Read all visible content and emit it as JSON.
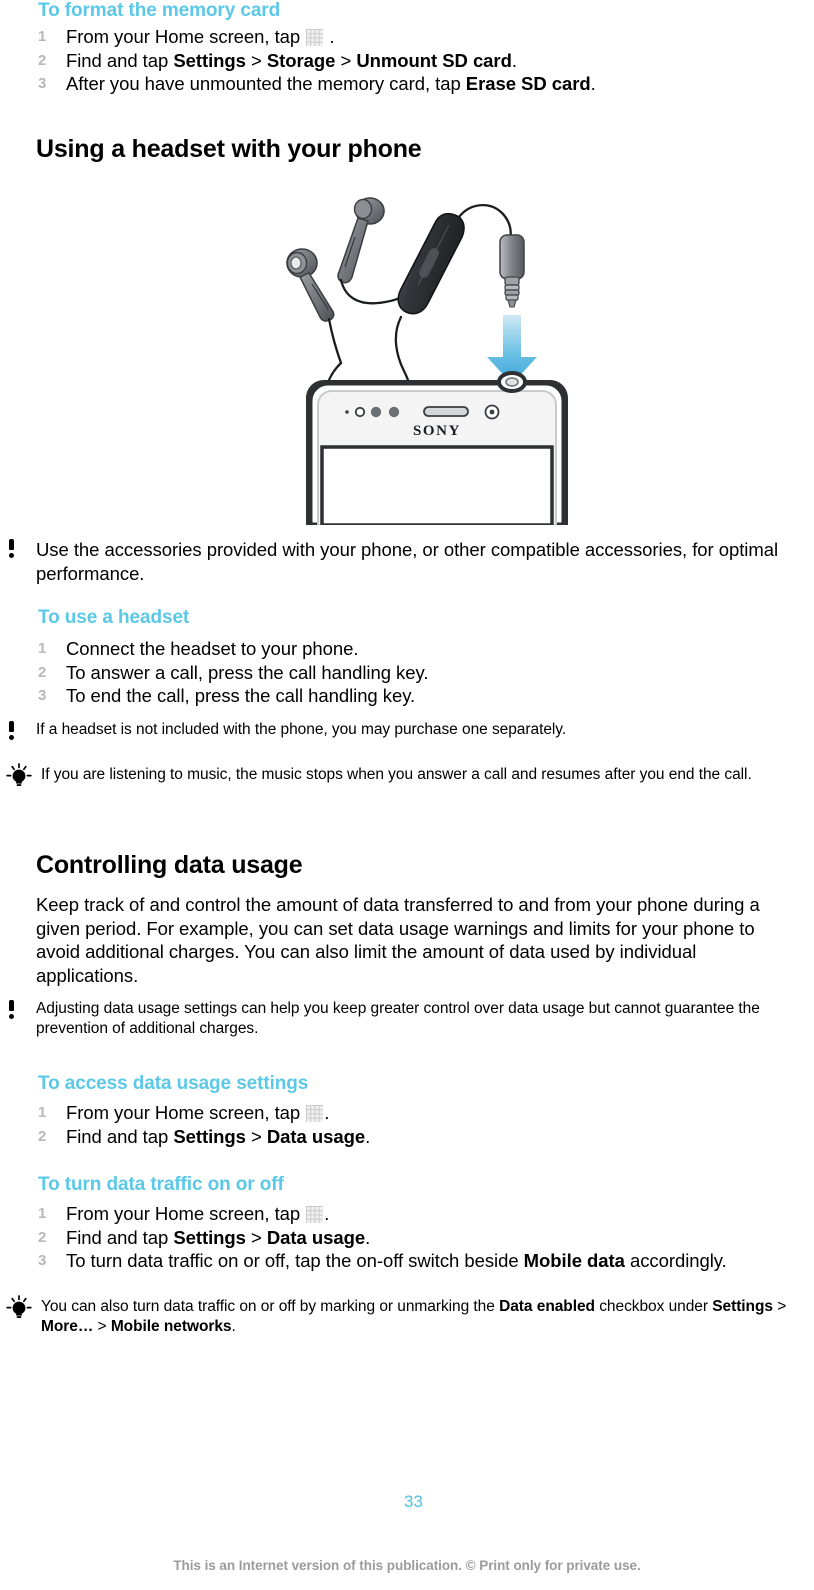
{
  "document": {
    "page_number": "33",
    "footer_note": "This is an Internet version of this publication. © Print only for private use.",
    "accent_color": "#5bc8e8",
    "page_number_color": "#4cc3e6",
    "footer_color": "#9b9b9b"
  },
  "sections": {
    "format_memory_card": {
      "heading": "To format the memory card",
      "steps": [
        {
          "num": "1",
          "pre": "From your Home screen, tap ",
          "icon": "app-drawer-grid-icon",
          "post": " ."
        },
        {
          "num": "2",
          "pre": "Find and tap ",
          "bold1": "Settings",
          "mid1": " > ",
          "bold2": "Storage",
          "mid2": " > ",
          "bold3": "Unmount SD card",
          "post": "."
        },
        {
          "num": "3",
          "pre": "After you have unmounted the memory card, tap ",
          "bold1": "Erase SD card",
          "post": "."
        }
      ]
    },
    "using_headset": {
      "heading": "Using a headset with your phone",
      "illustration": {
        "name": "headset-and-phone-illustration",
        "alt_parts": [
          "in-ear-earbuds",
          "inline-remote",
          "3.5mm-audio-jack",
          "blue-down-arrow",
          "sony-phone-top"
        ],
        "phone_brand": "SONY",
        "arrow_color": "#46b0de"
      },
      "note": "Use the accessories provided with your phone, or other compatible accessories, for optimal performance."
    },
    "use_headset": {
      "heading": "To use a headset",
      "steps": [
        {
          "num": "1",
          "text": "Connect the headset to your phone."
        },
        {
          "num": "2",
          "text": "To answer a call, press the call handling key."
        },
        {
          "num": "3",
          "text": "To end the call, press the call handling key."
        }
      ],
      "note": "If a headset is not included with the phone, you may purchase one separately.",
      "tip": "If you are listening to music, the music stops when you answer a call and resumes after you end the call."
    },
    "controlling_data_usage": {
      "heading": "Controlling data usage",
      "paragraph": "Keep track of and control the amount of data transferred to and from your phone during a given period. For example, you can set data usage warnings and limits for your phone to avoid additional charges. You can also limit the amount of data used by individual applications.",
      "note": "Adjusting data usage settings can help you keep greater control over data usage but cannot guarantee the prevention of additional charges."
    },
    "access_data_usage_settings": {
      "heading": "To access data usage settings",
      "steps": [
        {
          "num": "1",
          "pre": "From your Home screen, tap ",
          "icon": "app-drawer-grid-icon",
          "post": "."
        },
        {
          "num": "2",
          "pre": "Find and tap ",
          "bold1": "Settings",
          "mid1": " > ",
          "bold2": "Data usage",
          "post": "."
        }
      ]
    },
    "turn_data_traffic": {
      "heading": "To turn data traffic on or off",
      "steps": [
        {
          "num": "1",
          "pre": "From your Home screen, tap ",
          "icon": "app-drawer-grid-icon",
          "post": "."
        },
        {
          "num": "2",
          "pre": "Find and tap ",
          "bold1": "Settings",
          "mid1": " > ",
          "bold2": "Data usage",
          "post": "."
        },
        {
          "num": "3",
          "pre": "To turn data traffic on or off, tap the on-off switch beside ",
          "bold1": "Mobile data",
          "post": " accordingly."
        }
      ],
      "tip": {
        "pre": "You can also turn data traffic on or off by marking or unmarking the ",
        "bold1": "Data enabled",
        "mid1": " checkbox under ",
        "bold2": "Settings",
        "mid2": " > ",
        "bold3": "More…",
        "mid3": " > ",
        "bold4": "Mobile networks",
        "post": "."
      }
    }
  }
}
